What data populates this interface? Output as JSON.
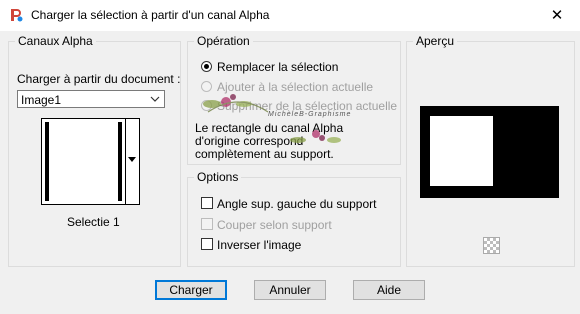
{
  "window": {
    "title": "Charger la sélection à partir d'un canal Alpha",
    "close_glyph": "✕",
    "app_icon": "paintshop-icon"
  },
  "canaux": {
    "legend": "Canaux Alpha",
    "load_from_label": "Charger à partir du document :",
    "document_value": "Image1",
    "selection_name": "Selectie 1"
  },
  "operation": {
    "legend": "Opération",
    "options": [
      {
        "label": "Remplacer la sélection",
        "checked": true,
        "enabled": true
      },
      {
        "label": "Ajouter à la sélection actuelle",
        "checked": false,
        "enabled": false
      },
      {
        "label": "Supprimer de la sélection actuelle",
        "checked": false,
        "enabled": false
      }
    ],
    "note_line1": "Le rectangle du canal Alpha",
    "note_line2": "d'origine correspond",
    "note_line3": "complètement au support."
  },
  "options": {
    "legend": "Options",
    "items": [
      {
        "label": "Angle sup. gauche du support",
        "checked": false,
        "enabled": true
      },
      {
        "label": "Couper selon support",
        "checked": false,
        "enabled": false
      },
      {
        "label": "Inverser l'image",
        "checked": false,
        "enabled": true
      }
    ]
  },
  "apercu": {
    "legend": "Aperçu",
    "zoom_icon": "checkerboard-icon"
  },
  "buttons": {
    "load": "Charger",
    "cancel": "Annuler",
    "help": "Aide"
  },
  "watermark_text": "MichèleB-Graphisme",
  "colors": {
    "default_button_border": "#0078d7",
    "window_bg": "#f0f0f0",
    "preview_bg": "#000000"
  }
}
